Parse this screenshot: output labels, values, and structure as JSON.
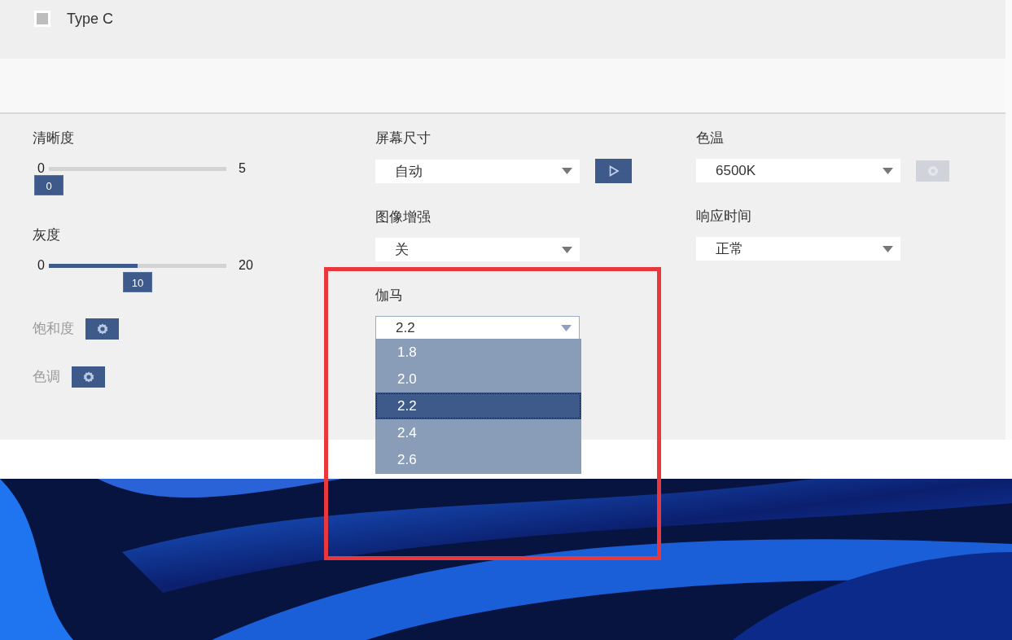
{
  "checkbox": {
    "label": "Type C",
    "checked": false,
    "disabled": true
  },
  "columns": [
    {
      "items": [
        {
          "kind": "slider",
          "label": "清晰度",
          "min": "0",
          "max": "5",
          "value": "0",
          "level": 0
        },
        {
          "kind": "slider",
          "label": "灰度",
          "min": "0",
          "max": "20",
          "value": "10",
          "level": 0.5
        },
        {
          "kind": "gear_row",
          "label": "饱和度",
          "disabled": true
        },
        {
          "kind": "gear_row",
          "label": "色调",
          "disabled": true
        }
      ]
    },
    {
      "items": [
        {
          "kind": "select",
          "label": "屏幕尺寸",
          "value": "自动",
          "expanded": false,
          "button": {
            "kind": "play",
            "disabled": false
          }
        },
        {
          "kind": "select",
          "label": "图像增强",
          "value": "关",
          "expanded": false
        },
        {
          "kind": "select",
          "label": "伽马",
          "value": "2.2",
          "expanded": true,
          "options": [
            {
              "label": "1.8",
              "selected": false
            },
            {
              "label": "2.0",
              "selected": false
            },
            {
              "label": "2.2",
              "selected": true
            },
            {
              "label": "2.4",
              "selected": false
            },
            {
              "label": "2.6",
              "selected": false
            }
          ]
        }
      ]
    },
    {
      "items": [
        {
          "kind": "select",
          "label": "色温",
          "value": "6500K",
          "expanded": false,
          "button": {
            "kind": "gear",
            "disabled": true
          }
        },
        {
          "kind": "select",
          "label": "响应时间",
          "value": "正常",
          "expanded": false
        }
      ]
    }
  ]
}
